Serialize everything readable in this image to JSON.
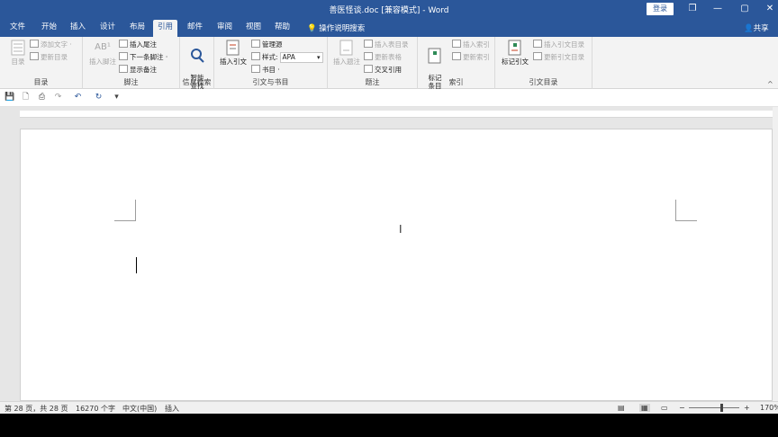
{
  "titlebar": {
    "title": "善医怪谈.doc [兼容模式]  -  Word",
    "login_label": "登录",
    "restore_glyph": "❐",
    "minimize_glyph": "—",
    "maximize_glyph": "▢",
    "close_glyph": "✕"
  },
  "tabs": [
    "文件",
    "开始",
    "插入",
    "设计",
    "布局",
    "引用",
    "邮件",
    "审阅",
    "视图",
    "帮助"
  ],
  "active_tab": "引用",
  "tell_me": "操作说明搜索",
  "share": "共享",
  "ribbon": {
    "toc": {
      "big": "目录",
      "add_text": "添加文字 ·",
      "update": "更新目录",
      "label": "目录"
    },
    "footnotes": {
      "big": "插入脚注",
      "insert_endnote": "插入尾注",
      "next_footnote": "下一条脚注 ·",
      "show_notes": "显示备注",
      "label": "脚注",
      "ab_icon": "AB¹"
    },
    "research": {
      "big": "智能\n查找",
      "label": "信息检索"
    },
    "citations": {
      "big": "插入引文",
      "manage": "管理源",
      "style_label": "样式:",
      "style_value": "APA",
      "bibliography": "书目 ·",
      "label": "引文与书目"
    },
    "captions": {
      "big": "插入题注",
      "insert_table": "插入表目录",
      "update_table": "更新表格",
      "cross_ref": "交叉引用",
      "label": "题注"
    },
    "index": {
      "big": "标记\n条目",
      "insert_index": "插入索引",
      "update_index": "更新索引",
      "label": "索引"
    },
    "toa": {
      "big": "标记引文",
      "insert_toa": "插入引文目录",
      "update_toa": "更新引文目录",
      "label": "引文目录"
    }
  },
  "statusbar": {
    "page": "第 28 页，共 28 页",
    "words": "16270 个字",
    "language": "中文(中国)",
    "mode": "插入",
    "zoom": "170%"
  }
}
